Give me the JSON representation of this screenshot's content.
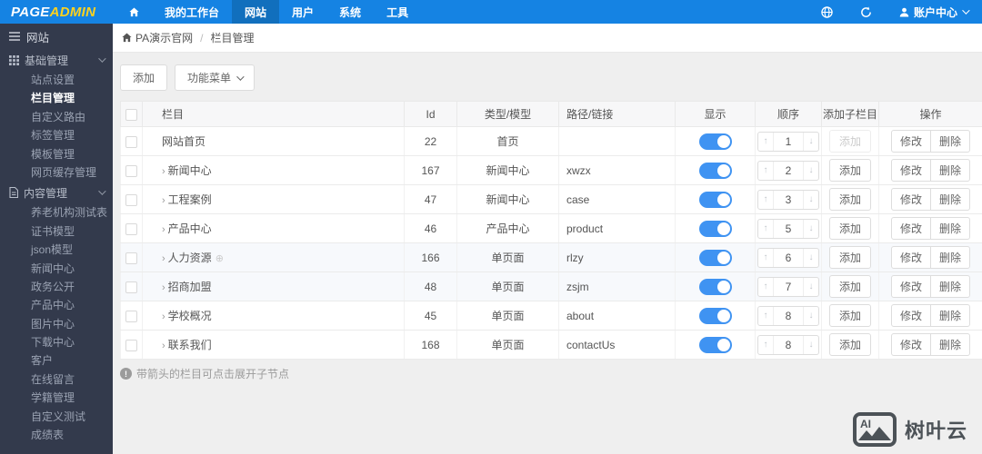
{
  "topbar": {
    "logo_part1": "PAGE",
    "logo_part2": "ADMIN",
    "nav": [
      {
        "name": "home",
        "icon": "home-icon",
        "label": "",
        "active": false
      },
      {
        "name": "workbench",
        "label": "我的工作台",
        "active": false
      },
      {
        "name": "website",
        "label": "网站",
        "active": true
      },
      {
        "name": "users",
        "label": "用户",
        "active": false
      },
      {
        "name": "system",
        "label": "系统",
        "active": false
      },
      {
        "name": "tools",
        "label": "工具",
        "active": false
      }
    ],
    "account_label": "账户中心"
  },
  "sidebar": {
    "header": "网站",
    "groups": [
      {
        "label": "基础管理",
        "icon": "grid-icon",
        "items": [
          "站点设置",
          "栏目管理",
          "自定义路由",
          "标签管理",
          "模板管理",
          "网页缓存管理"
        ],
        "active_item": "栏目管理"
      },
      {
        "label": "内容管理",
        "icon": "file-icon",
        "items": [
          "养老机构测试表",
          "证书模型",
          "json模型",
          "新闻中心",
          "政务公开",
          "产品中心",
          "图片中心",
          "下载中心",
          "客户",
          "在线留言",
          "学籍管理",
          "自定义测试",
          "成绩表"
        ],
        "active_item": ""
      }
    ]
  },
  "breadcrumb": {
    "site": "PA演示官网",
    "separator": "/",
    "page": "栏目管理"
  },
  "toolbar": {
    "add_label": "添加",
    "menu_label": "功能菜单"
  },
  "table": {
    "headers": [
      "栏目",
      "Id",
      "类型/模型",
      "路径/链接",
      "显示",
      "顺序",
      "添加子栏目",
      "操作"
    ],
    "add_child_label": "添加",
    "edit_label": "修改",
    "delete_label": "删除",
    "rows": [
      {
        "name": "网站首页",
        "has_arrow": false,
        "id": "22",
        "type": "首页",
        "path": "",
        "visible": true,
        "order": "1",
        "add_disabled": true,
        "extra_icon": ""
      },
      {
        "name": "新闻中心",
        "has_arrow": true,
        "id": "167",
        "type": "新闻中心",
        "path": "xwzx",
        "visible": true,
        "order": "2",
        "add_disabled": false,
        "extra_icon": ""
      },
      {
        "name": "工程案例",
        "has_arrow": true,
        "id": "47",
        "type": "新闻中心",
        "path": "case",
        "visible": true,
        "order": "3",
        "add_disabled": false,
        "extra_icon": ""
      },
      {
        "name": "产品中心",
        "has_arrow": true,
        "id": "46",
        "type": "产品中心",
        "path": "product",
        "visible": true,
        "order": "5",
        "add_disabled": false,
        "extra_icon": ""
      },
      {
        "name": "人力资源",
        "has_arrow": true,
        "id": "166",
        "type": "单页面",
        "path": "rlzy",
        "visible": true,
        "order": "6",
        "add_disabled": false,
        "extra_icon": "globe-small-icon"
      },
      {
        "name": "招商加盟",
        "has_arrow": true,
        "id": "48",
        "type": "单页面",
        "path": "zsjm",
        "visible": true,
        "order": "7",
        "add_disabled": false,
        "extra_icon": ""
      },
      {
        "name": "学校概况",
        "has_arrow": true,
        "id": "45",
        "type": "单页面",
        "path": "about",
        "visible": true,
        "order": "8",
        "add_disabled": false,
        "extra_icon": ""
      },
      {
        "name": "联系我们",
        "has_arrow": true,
        "id": "168",
        "type": "单页面",
        "path": "contactUs",
        "visible": true,
        "order": "8",
        "add_disabled": false,
        "extra_icon": ""
      }
    ]
  },
  "footnote": "带箭头的栏目可点击展开子节点",
  "watermark": {
    "logo_text": "AI",
    "text": "树叶云"
  },
  "colors": {
    "topbar_blue": "#1583e3",
    "topbar_active_blue": "#116fbd",
    "logo_yellow": "#ffd21e",
    "sidebar_dark": "#333a4c",
    "toggle_on_blue": "#3f93f2",
    "content_bg": "#efefef"
  }
}
